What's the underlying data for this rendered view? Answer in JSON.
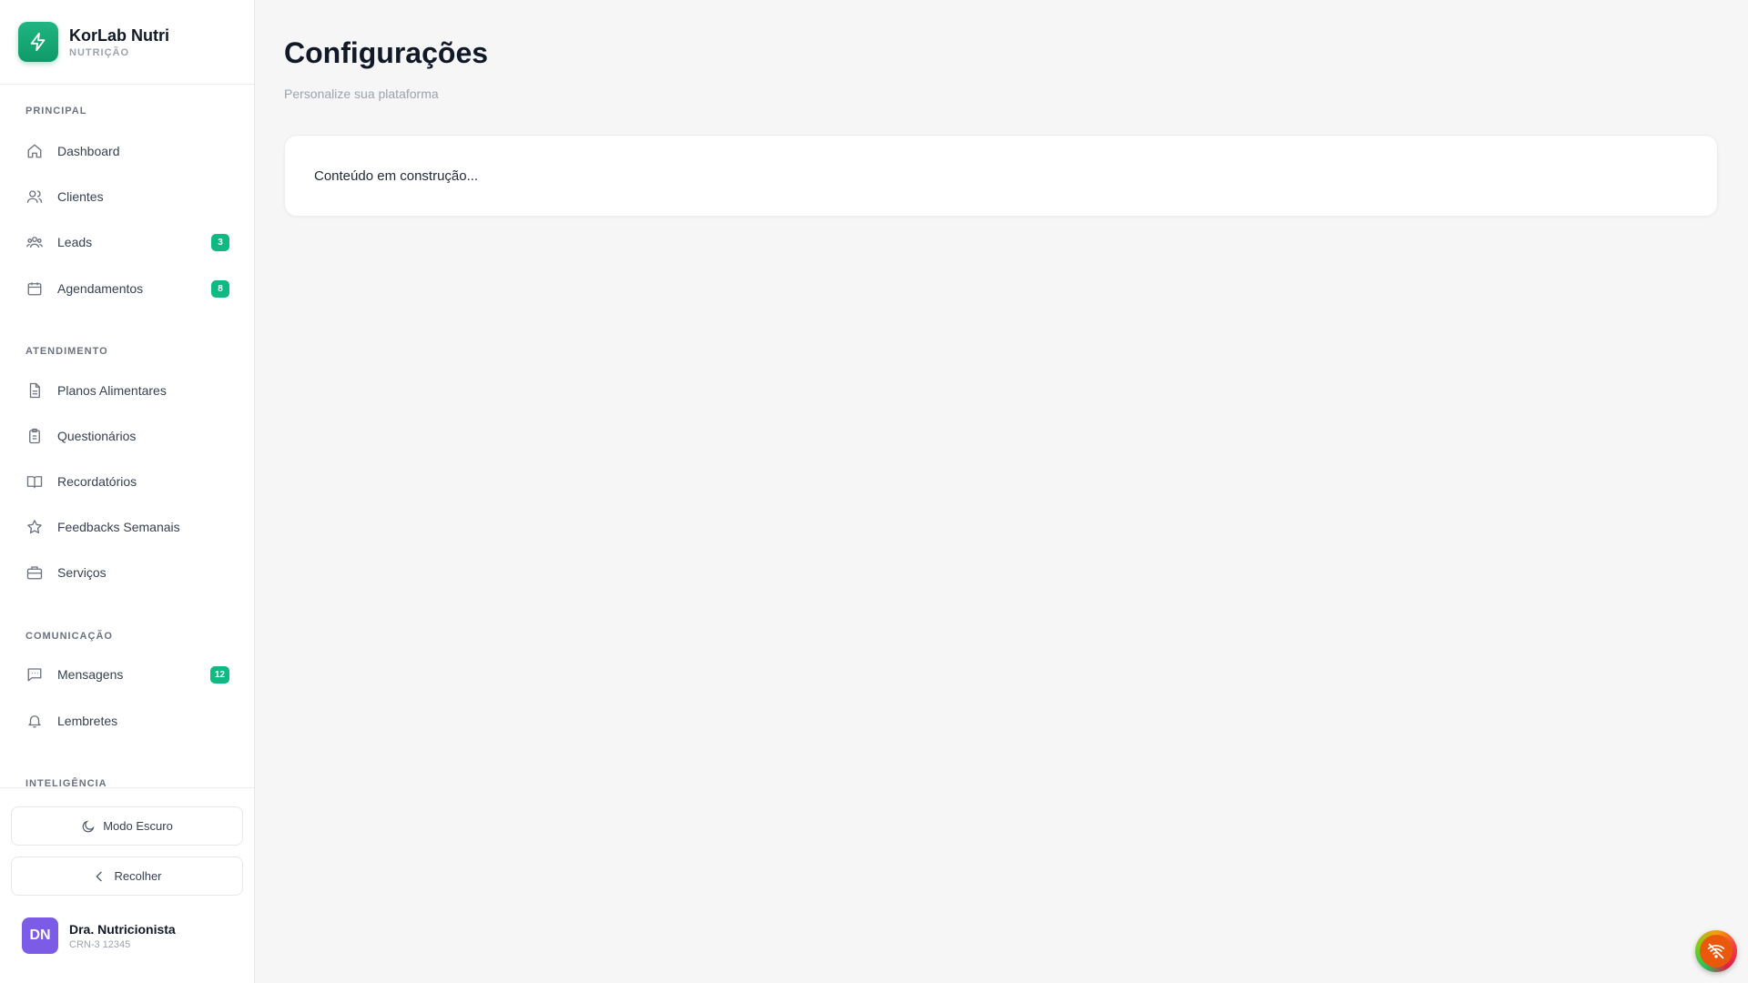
{
  "brand": {
    "name": "KorLab Nutri",
    "subtitle": "NUTRIÇÃO"
  },
  "sections": {
    "principal": "PRINCIPAL",
    "atendimento": "ATENDIMENTO",
    "comunicacao": "COMUNICAÇÃO",
    "inteligencia": "INTELIGÊNCIA"
  },
  "nav": {
    "dashboard": {
      "label": "Dashboard",
      "icon": "home-icon"
    },
    "clientes": {
      "label": "Clientes",
      "icon": "users-icon"
    },
    "leads": {
      "label": "Leads",
      "icon": "group-icon",
      "badge": "3"
    },
    "agendamentos": {
      "label": "Agendamentos",
      "icon": "calendar-icon",
      "badge": "8"
    },
    "planos": {
      "label": "Planos Alimentares",
      "icon": "document-icon"
    },
    "questionarios": {
      "label": "Questionários",
      "icon": "clipboard-icon"
    },
    "recordatorios": {
      "label": "Recordatórios",
      "icon": "book-icon"
    },
    "feedbacks": {
      "label": "Feedbacks Semanais",
      "icon": "star-icon"
    },
    "servicos": {
      "label": "Serviços",
      "icon": "briefcase-icon"
    },
    "mensagens": {
      "label": "Mensagens",
      "icon": "message-icon",
      "badge": "12"
    },
    "lembretes": {
      "label": "Lembretes",
      "icon": "bell-icon"
    }
  },
  "footer": {
    "dark_mode": "Modo Escuro",
    "collapse": "Recolher",
    "user_initials": "DN",
    "user_name": "Dra. Nutricionista",
    "user_crn": "CRN-3 12345"
  },
  "page": {
    "title": "Configurações",
    "subtitle": "Personalize sua plataforma",
    "content": "Conteúdo em construção..."
  },
  "colors": {
    "accent": "#10b981",
    "avatar": "#7c5ce6"
  }
}
